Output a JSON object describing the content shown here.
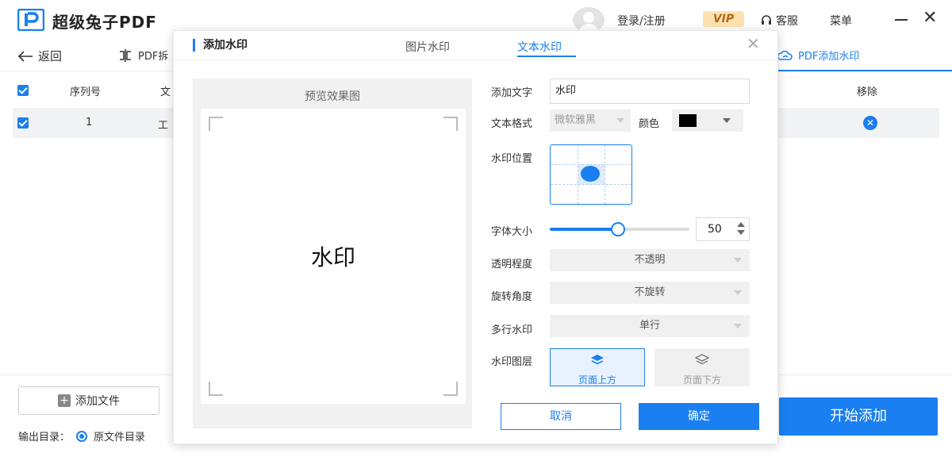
{
  "app": {
    "title": "超级兔子PDF",
    "login_label": "登录/注册",
    "vip_label": "VIP",
    "service_label": "客服",
    "menu_label": "菜单"
  },
  "toolbar": {
    "back_label": "返回",
    "tool_label": "PDF拆",
    "active_tool_label": "PDF添加水印"
  },
  "table": {
    "columns": [
      "序列号",
      "文",
      "移除"
    ],
    "rows": [
      {
        "index": "1",
        "name": "工"
      }
    ]
  },
  "bottom": {
    "add_file_label": "添加文件",
    "output_dir_label": "输出目录：",
    "output_dir_option": "原文件目录",
    "start_label": "开始添加"
  },
  "modal": {
    "title": "添加水印",
    "tabs": [
      "图片水印",
      "文本水印"
    ],
    "active_tab": "文本水印",
    "preview_title": "预览效果图",
    "preview_watermark": "水印",
    "labels": {
      "text": "添加文字",
      "format": "文本格式",
      "color": "颜色",
      "position": "水印位置",
      "size": "字体大小",
      "opacity": "透明程度",
      "rotation": "旋转角度",
      "multiline": "多行水印",
      "layer": "水印图层"
    },
    "text_value": "水印",
    "font_value": "微软雅黑",
    "color_value": "#000000",
    "position_value": "center",
    "font_size": {
      "value": "50",
      "slider_fraction": 0.49
    },
    "opacity_value": "不透明",
    "rotation_value": "不旋转",
    "multiline_value": "单行",
    "layer_options": [
      "页面上方",
      "页面下方"
    ],
    "layer_selected": "页面上方",
    "cancel_label": "取消",
    "ok_label": "确定"
  },
  "colors": {
    "accent": "#1a7ff0",
    "vip_bg": "#fde3b0",
    "vip_text": "#b5651d"
  }
}
